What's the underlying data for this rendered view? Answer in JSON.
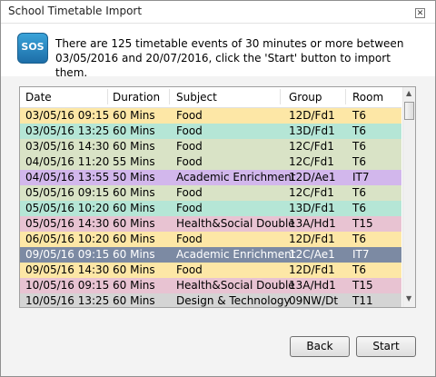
{
  "window": {
    "title": "School Timetable Import",
    "close_glyph": "✕"
  },
  "header": {
    "icon_text": "SOS",
    "message": "There are 125 timetable events of 30 minutes or more between 03/05/2016 and 20/07/2016, click the 'Start' button to import them."
  },
  "table": {
    "columns": [
      "Date",
      "Duration",
      "Subject",
      "Group",
      "Room"
    ],
    "rows": [
      {
        "date": "03/05/16 09:15",
        "duration": "60 Mins",
        "subject": "Food",
        "group": "12D/Fd1",
        "room": "T6",
        "color": "#fde7a6"
      },
      {
        "date": "03/05/16 13:25",
        "duration": "60 Mins",
        "subject": "Food",
        "group": "13D/Fd1",
        "room": "T6",
        "color": "#b5e6d6"
      },
      {
        "date": "03/05/16 14:30",
        "duration": "60 Mins",
        "subject": "Food",
        "group": "12C/Fd1",
        "room": "T6",
        "color": "#d9e3c6"
      },
      {
        "date": "04/05/16 11:20",
        "duration": "55 Mins",
        "subject": "Food",
        "group": "12C/Fd1",
        "room": "T6",
        "color": "#d9e3c6"
      },
      {
        "date": "04/05/16 13:55",
        "duration": "50 Mins",
        "subject": "Academic Enrichment",
        "group": "12D/Ae1",
        "room": "IT7",
        "color": "#d2b7ec"
      },
      {
        "date": "05/05/16 09:15",
        "duration": "60 Mins",
        "subject": "Food",
        "group": "12C/Fd1",
        "room": "T6",
        "color": "#d9e3c6"
      },
      {
        "date": "05/05/16 10:20",
        "duration": "60 Mins",
        "subject": "Food",
        "group": "13D/Fd1",
        "room": "T6",
        "color": "#b5e6d6"
      },
      {
        "date": "05/05/16 14:30",
        "duration": "60 Mins",
        "subject": "Health&Social Double",
        "group": "13A/Hd1",
        "room": "T15",
        "color": "#e8c3d2"
      },
      {
        "date": "06/05/16 10:20",
        "duration": "60 Mins",
        "subject": "Food",
        "group": "12D/Fd1",
        "room": "T6",
        "color": "#fde7a6"
      },
      {
        "date": "09/05/16 09:15",
        "duration": "60 Mins",
        "subject": "Academic Enrichment",
        "group": "12C/Ae1",
        "room": "IT7",
        "color": "#7c8aa3",
        "selected": true
      },
      {
        "date": "09/05/16 14:30",
        "duration": "60 Mins",
        "subject": "Food",
        "group": "12D/Fd1",
        "room": "T6",
        "color": "#fde7a6"
      },
      {
        "date": "10/05/16 09:15",
        "duration": "60 Mins",
        "subject": "Health&Social Double",
        "group": "13A/Hd1",
        "room": "T15",
        "color": "#e8c3d2"
      },
      {
        "date": "10/05/16 13:25",
        "duration": "60 Mins",
        "subject": "Design & Technology",
        "group": "09NW/Dt",
        "room": "T11",
        "color": "#d4d4d4"
      }
    ]
  },
  "buttons": {
    "back": "Back",
    "start": "Start"
  },
  "icons": {
    "scroll_up": "▲",
    "scroll_down": "▼"
  }
}
